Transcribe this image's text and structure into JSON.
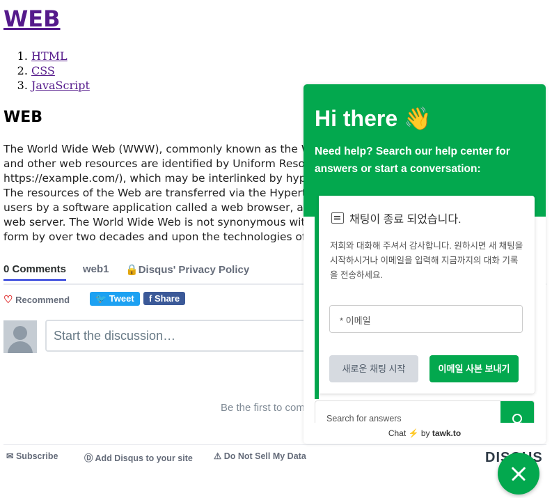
{
  "page": {
    "site_title": "WEB",
    "toc": [
      "HTML",
      "CSS",
      "JavaScript"
    ],
    "section_title": "WEB",
    "body_lines": [
      "The World Wide Web (WWW), commonly known as the We",
      "and other web resources are identified by Uniform Resourc",
      "https://example.com/), which may be interlinked by hyperli",
      "The resources of the Web are transferred via the Hypertext",
      "users by a software application called a web browser, and a",
      "web server. The World Wide Web is not synonymous with t",
      "form by over two decades and upon the technologies of w"
    ]
  },
  "disqus": {
    "tabs": {
      "comments": "0 Comments",
      "community": "web1",
      "privacy": "Disqus' Privacy Policy"
    },
    "recommend": "Recommend",
    "tweet": "Tweet",
    "share": "Share",
    "placeholder": "Start the discussion…",
    "first_comment": "Be the first to com",
    "footer": {
      "subscribe": "Subscribe",
      "add": "Add Disqus to your site",
      "dnsmd": "Do Not Sell My Data"
    },
    "logo": "DISQUS"
  },
  "tawk": {
    "greeting": "Hi there 👋",
    "subtitle": "Need help? Search our help center for answers or start a conversation:",
    "card_title": "채팅이 종료 되었습니다.",
    "card_text": "저희와 대화해 주셔서 감사합니다. 원하시면 새 채팅을 시작하시거나 이메일을 입력해 지금까지의 대화 기록을 전송하세요.",
    "email_placeholder": "* 이메일",
    "new_chat": "새로운 채팅 시작",
    "send_transcript": "이메일 사본 보내기",
    "search_placeholder": "Search for answers",
    "footer_chat": "Chat",
    "footer_by": "by",
    "footer_brand": "tawk.to",
    "brand_color": "#03a84e"
  }
}
